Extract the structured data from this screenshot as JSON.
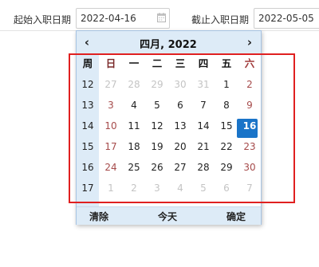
{
  "filters": {
    "start_label": "起始入职日期",
    "start_value": "2022-04-16",
    "end_label": "截止入职日期",
    "end_value": "2022-05-05"
  },
  "picker": {
    "prev": "‹",
    "next": "›",
    "title": "四月, 2022",
    "week_header": "周",
    "weekdays": [
      "日",
      "一",
      "二",
      "三",
      "四",
      "五",
      "六"
    ],
    "weeks": [
      {
        "no": "12",
        "days": [
          "27",
          "28",
          "29",
          "30",
          "31",
          "1",
          "2"
        ]
      },
      {
        "no": "13",
        "days": [
          "3",
          "4",
          "5",
          "6",
          "7",
          "8",
          "9"
        ]
      },
      {
        "no": "14",
        "days": [
          "10",
          "11",
          "12",
          "13",
          "14",
          "15",
          "16"
        ]
      },
      {
        "no": "15",
        "days": [
          "17",
          "18",
          "19",
          "20",
          "21",
          "22",
          "23"
        ]
      },
      {
        "no": "16",
        "days": [
          "24",
          "25",
          "26",
          "27",
          "28",
          "29",
          "30"
        ]
      },
      {
        "no": "17",
        "days": [
          "1",
          "2",
          "3",
          "4",
          "5",
          "6",
          "7"
        ]
      }
    ],
    "selected_day": "16",
    "footer": {
      "clear": "清除",
      "today": "今天",
      "ok": "确定"
    }
  },
  "colors": {
    "selected": "#1a74c8",
    "header_bg": "#ddebf7",
    "highlight_border": "#e02020"
  }
}
